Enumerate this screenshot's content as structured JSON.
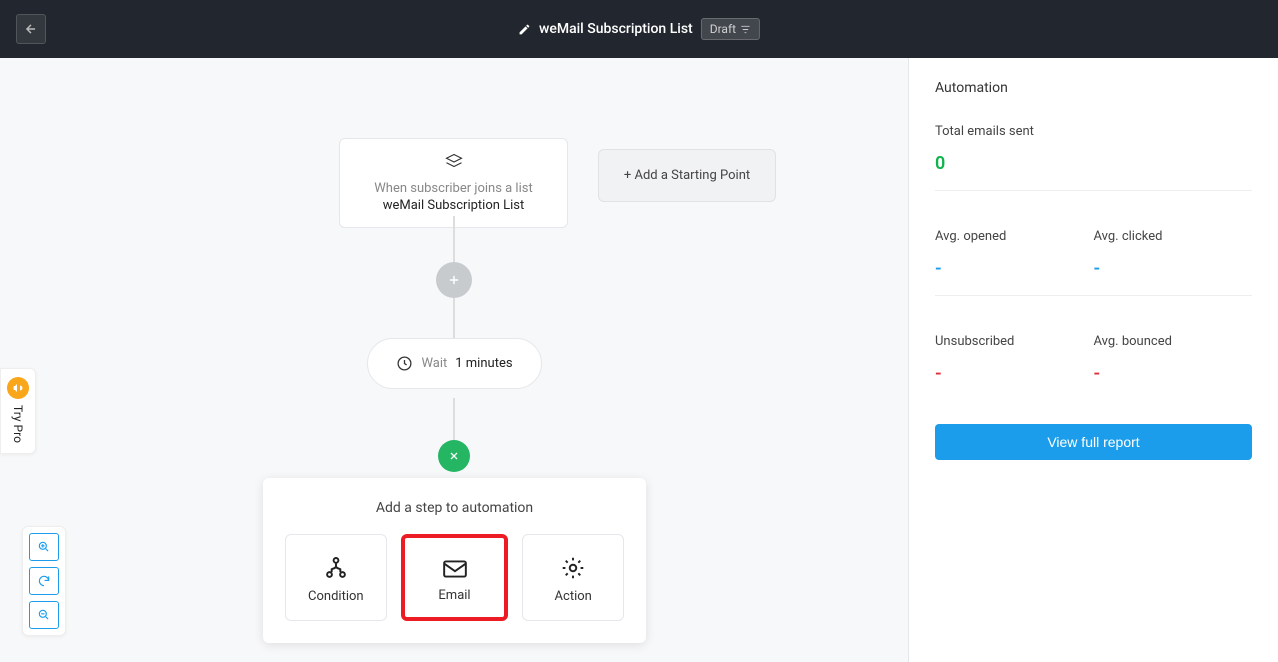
{
  "header": {
    "title": "weMail Subscription List",
    "badge": "Draft"
  },
  "canvas": {
    "trigger_desc": "When subscriber joins a list",
    "trigger_name": "weMail Subscription List",
    "start_label": "+ Add a Starting Point",
    "wait_label": "Wait",
    "wait_value": "1 minutes",
    "popover_title": "Add a step to automation",
    "options": {
      "condition": "Condition",
      "email": "Email",
      "action": "Action"
    }
  },
  "sidebar": {
    "title": "Automation",
    "total_label": "Total emails sent",
    "total_value": "0",
    "avg_opened_label": "Avg. opened",
    "avg_opened_value": "-",
    "avg_clicked_label": "Avg. clicked",
    "avg_clicked_value": "-",
    "unsubscribed_label": "Unsubscribed",
    "unsubscribed_value": "-",
    "avg_bounced_label": "Avg. bounced",
    "avg_bounced_value": "-",
    "report_btn": "View full report"
  },
  "try_pro": "Try Pro"
}
